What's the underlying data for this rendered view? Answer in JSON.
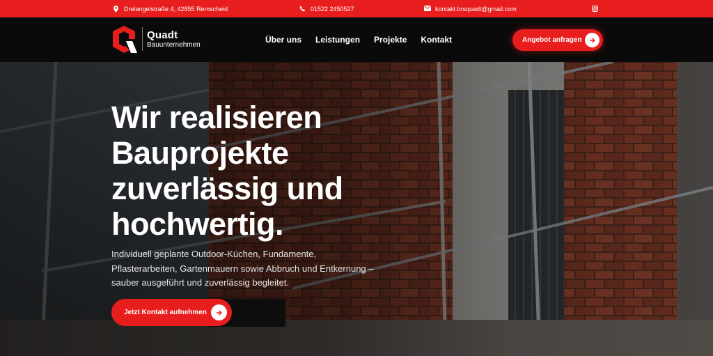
{
  "topbar": {
    "address": "Drelangelstraße 4, 42855 Remscheid",
    "phone": "01522 2450527",
    "email": "kontakt.brsquadt@gmail.com",
    "icons": [
      "location-pin-icon",
      "phone-icon",
      "mail-icon",
      "instagram-icon"
    ]
  },
  "brand": {
    "name": "Quadt",
    "subtitle": "Bauunternehmen"
  },
  "nav": {
    "items": [
      {
        "label": "Über uns"
      },
      {
        "label": "Leistungen"
      },
      {
        "label": "Projekte"
      },
      {
        "label": "Kontakt"
      }
    ],
    "cta_label": "Angebot anfragen"
  },
  "hero": {
    "headline": "Wir realisieren Bauprojekte zuverlässig und hochwertig.",
    "description": "Individuell geplante Outdoor-Küchen, Fundamente, Pflasterarbeiten, Gartenmauern sowie Abbruch und Entkernung – sauber ausgeführt und zuverlässig begleitet.",
    "cta_label": "Jetzt Kontakt aufnehmen"
  },
  "colors": {
    "accent": "#e81e1e",
    "nav_bg": "#0a0a0a",
    "text": "#ffffff"
  }
}
